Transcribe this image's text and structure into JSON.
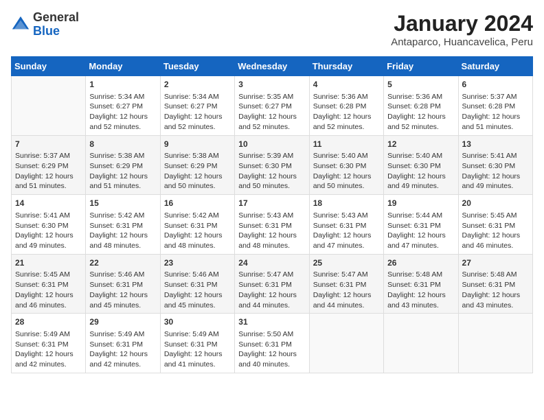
{
  "header": {
    "logo_general": "General",
    "logo_blue": "Blue",
    "month_year": "January 2024",
    "location": "Antaparco, Huancavelica, Peru"
  },
  "days_of_week": [
    "Sunday",
    "Monday",
    "Tuesday",
    "Wednesday",
    "Thursday",
    "Friday",
    "Saturday"
  ],
  "weeks": [
    [
      {
        "day": "",
        "info": ""
      },
      {
        "day": "1",
        "info": "Sunrise: 5:34 AM\nSunset: 6:27 PM\nDaylight: 12 hours\nand 52 minutes."
      },
      {
        "day": "2",
        "info": "Sunrise: 5:34 AM\nSunset: 6:27 PM\nDaylight: 12 hours\nand 52 minutes."
      },
      {
        "day": "3",
        "info": "Sunrise: 5:35 AM\nSunset: 6:27 PM\nDaylight: 12 hours\nand 52 minutes."
      },
      {
        "day": "4",
        "info": "Sunrise: 5:36 AM\nSunset: 6:28 PM\nDaylight: 12 hours\nand 52 minutes."
      },
      {
        "day": "5",
        "info": "Sunrise: 5:36 AM\nSunset: 6:28 PM\nDaylight: 12 hours\nand 52 minutes."
      },
      {
        "day": "6",
        "info": "Sunrise: 5:37 AM\nSunset: 6:28 PM\nDaylight: 12 hours\nand 51 minutes."
      }
    ],
    [
      {
        "day": "7",
        "info": "Sunrise: 5:37 AM\nSunset: 6:29 PM\nDaylight: 12 hours\nand 51 minutes."
      },
      {
        "day": "8",
        "info": "Sunrise: 5:38 AM\nSunset: 6:29 PM\nDaylight: 12 hours\nand 51 minutes."
      },
      {
        "day": "9",
        "info": "Sunrise: 5:38 AM\nSunset: 6:29 PM\nDaylight: 12 hours\nand 50 minutes."
      },
      {
        "day": "10",
        "info": "Sunrise: 5:39 AM\nSunset: 6:30 PM\nDaylight: 12 hours\nand 50 minutes."
      },
      {
        "day": "11",
        "info": "Sunrise: 5:40 AM\nSunset: 6:30 PM\nDaylight: 12 hours\nand 50 minutes."
      },
      {
        "day": "12",
        "info": "Sunrise: 5:40 AM\nSunset: 6:30 PM\nDaylight: 12 hours\nand 49 minutes."
      },
      {
        "day": "13",
        "info": "Sunrise: 5:41 AM\nSunset: 6:30 PM\nDaylight: 12 hours\nand 49 minutes."
      }
    ],
    [
      {
        "day": "14",
        "info": "Sunrise: 5:41 AM\nSunset: 6:30 PM\nDaylight: 12 hours\nand 49 minutes."
      },
      {
        "day": "15",
        "info": "Sunrise: 5:42 AM\nSunset: 6:31 PM\nDaylight: 12 hours\nand 48 minutes."
      },
      {
        "day": "16",
        "info": "Sunrise: 5:42 AM\nSunset: 6:31 PM\nDaylight: 12 hours\nand 48 minutes."
      },
      {
        "day": "17",
        "info": "Sunrise: 5:43 AM\nSunset: 6:31 PM\nDaylight: 12 hours\nand 48 minutes."
      },
      {
        "day": "18",
        "info": "Sunrise: 5:43 AM\nSunset: 6:31 PM\nDaylight: 12 hours\nand 47 minutes."
      },
      {
        "day": "19",
        "info": "Sunrise: 5:44 AM\nSunset: 6:31 PM\nDaylight: 12 hours\nand 47 minutes."
      },
      {
        "day": "20",
        "info": "Sunrise: 5:45 AM\nSunset: 6:31 PM\nDaylight: 12 hours\nand 46 minutes."
      }
    ],
    [
      {
        "day": "21",
        "info": "Sunrise: 5:45 AM\nSunset: 6:31 PM\nDaylight: 12 hours\nand 46 minutes."
      },
      {
        "day": "22",
        "info": "Sunrise: 5:46 AM\nSunset: 6:31 PM\nDaylight: 12 hours\nand 45 minutes."
      },
      {
        "day": "23",
        "info": "Sunrise: 5:46 AM\nSunset: 6:31 PM\nDaylight: 12 hours\nand 45 minutes."
      },
      {
        "day": "24",
        "info": "Sunrise: 5:47 AM\nSunset: 6:31 PM\nDaylight: 12 hours\nand 44 minutes."
      },
      {
        "day": "25",
        "info": "Sunrise: 5:47 AM\nSunset: 6:31 PM\nDaylight: 12 hours\nand 44 minutes."
      },
      {
        "day": "26",
        "info": "Sunrise: 5:48 AM\nSunset: 6:31 PM\nDaylight: 12 hours\nand 43 minutes."
      },
      {
        "day": "27",
        "info": "Sunrise: 5:48 AM\nSunset: 6:31 PM\nDaylight: 12 hours\nand 43 minutes."
      }
    ],
    [
      {
        "day": "28",
        "info": "Sunrise: 5:49 AM\nSunset: 6:31 PM\nDaylight: 12 hours\nand 42 minutes."
      },
      {
        "day": "29",
        "info": "Sunrise: 5:49 AM\nSunset: 6:31 PM\nDaylight: 12 hours\nand 42 minutes."
      },
      {
        "day": "30",
        "info": "Sunrise: 5:49 AM\nSunset: 6:31 PM\nDaylight: 12 hours\nand 41 minutes."
      },
      {
        "day": "31",
        "info": "Sunrise: 5:50 AM\nSunset: 6:31 PM\nDaylight: 12 hours\nand 40 minutes."
      },
      {
        "day": "",
        "info": ""
      },
      {
        "day": "",
        "info": ""
      },
      {
        "day": "",
        "info": ""
      }
    ]
  ]
}
